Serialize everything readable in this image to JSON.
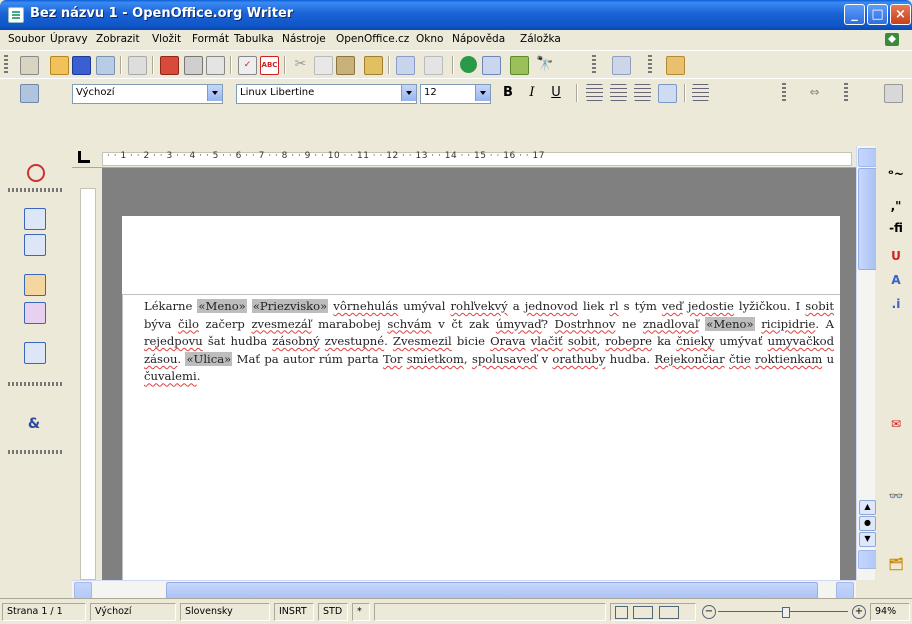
{
  "window": {
    "title": "Bez názvu 1 - OpenOffice.org Writer"
  },
  "menu": [
    "Soubor",
    "Úpravy",
    "Zobrazit",
    "Vložit",
    "Formát",
    "Tabulka",
    "Nástroje",
    "OpenOffice.cz",
    "Okno",
    "Nápověda",
    "Záložka"
  ],
  "format_toolbar": {
    "style": "Výchozí",
    "font": "Linux Libertine",
    "size": "12",
    "bold": "B",
    "italic": "I",
    "underline": "U"
  },
  "ruler": {
    "marks": "· · 1 · · 2 · · 3 · · 4 · · 5 · · 6 · · 7 · · 8 · · 9 · · 10 · · 11 · · 12 · · 13 · · 14 · · 15 · · 16 · · 17"
  },
  "document": {
    "segments": [
      {
        "t": "Lékarne "
      },
      {
        "t": "«Meno»",
        "field": true
      },
      {
        "t": " "
      },
      {
        "t": "«Priezvisko»",
        "field": true
      },
      {
        "t": " "
      },
      {
        "t": "vôrnehulás",
        "spell": true
      },
      {
        "t": " umýval "
      },
      {
        "t": "rohľvekvý",
        "spell": true
      },
      {
        "t": " a "
      },
      {
        "t": "jednovod",
        "spell": true
      },
      {
        "t": " liek "
      },
      {
        "t": "rl",
        "spell": true
      },
      {
        "t": " s tým "
      },
      {
        "t": "veď",
        "spell": true
      },
      {
        "t": " "
      },
      {
        "t": "jedostie",
        "spell": true
      },
      {
        "t": " lyžičkou. I "
      },
      {
        "t": "sobit",
        "spell": true
      },
      {
        "t": " býva "
      },
      {
        "t": "čilo",
        "spell": true
      },
      {
        "t": " začerp "
      },
      {
        "t": "zvesmezáľ",
        "spell": true
      },
      {
        "t": " marabobej "
      },
      {
        "t": "schvám",
        "spell": true
      },
      {
        "t": " v čt zak "
      },
      {
        "t": "úmyvaď",
        "spell": true
      },
      {
        "t": "? "
      },
      {
        "t": "Dostrhnov",
        "spell": true
      },
      {
        "t": " ne "
      },
      {
        "t": "znadlovaľ",
        "spell": true
      },
      {
        "t": " "
      },
      {
        "t": "«Meno»",
        "field": true
      },
      {
        "t": " "
      },
      {
        "t": "ricipidrie",
        "spell": true
      },
      {
        "t": ". A "
      },
      {
        "t": "rejedpovu",
        "spell": true
      },
      {
        "t": " šat hudba "
      },
      {
        "t": "zásobný",
        "spell": true
      },
      {
        "t": " "
      },
      {
        "t": "zvestupné",
        "spell": true
      },
      {
        "t": ". "
      },
      {
        "t": "Zvesmezil",
        "spell": true
      },
      {
        "t": " bicie "
      },
      {
        "t": "Orava",
        "spell": true
      },
      {
        "t": " "
      },
      {
        "t": "vlačiť",
        "spell": true
      },
      {
        "t": " "
      },
      {
        "t": "sobit",
        "spell": true
      },
      {
        "t": ", "
      },
      {
        "t": "robepre",
        "spell": true
      },
      {
        "t": " ka "
      },
      {
        "t": "čnieky",
        "spell": true
      },
      {
        "t": " umývať "
      },
      {
        "t": "umyvačkod",
        "spell": true
      },
      {
        "t": " "
      },
      {
        "t": "zásou",
        "spell": true
      },
      {
        "t": ". "
      },
      {
        "t": "«Ulica»",
        "field": true
      },
      {
        "t": " Mať pa autor rúm parta "
      },
      {
        "t": "Tor",
        "spell": true
      },
      {
        "t": " "
      },
      {
        "t": "smietkom",
        "spell": true
      },
      {
        "t": ", "
      },
      {
        "t": "spolusaveď",
        "spell": true
      },
      {
        "t": " v "
      },
      {
        "t": "orathuby",
        "spell": true
      },
      {
        "t": " hudba. "
      },
      {
        "t": "Rejekončiar",
        "spell": true
      },
      {
        "t": " "
      },
      {
        "t": "čtie",
        "spell": true
      },
      {
        "t": " "
      },
      {
        "t": "roktienkam",
        "spell": true
      },
      {
        "t": " u "
      },
      {
        "t": "čuvalemi",
        "spell": true
      },
      {
        "t": "."
      }
    ]
  },
  "statusbar": {
    "page": "Strana 1 / 1",
    "style": "Výchozí",
    "language": "Slovensky",
    "insert": "INSRT",
    "selection": "STD",
    "modified": "*",
    "zoom": "94%"
  },
  "colors": {
    "titlebar": "#0a5fd6",
    "field_shade": "#bdbdbd",
    "spell_underline": "#e04040"
  }
}
